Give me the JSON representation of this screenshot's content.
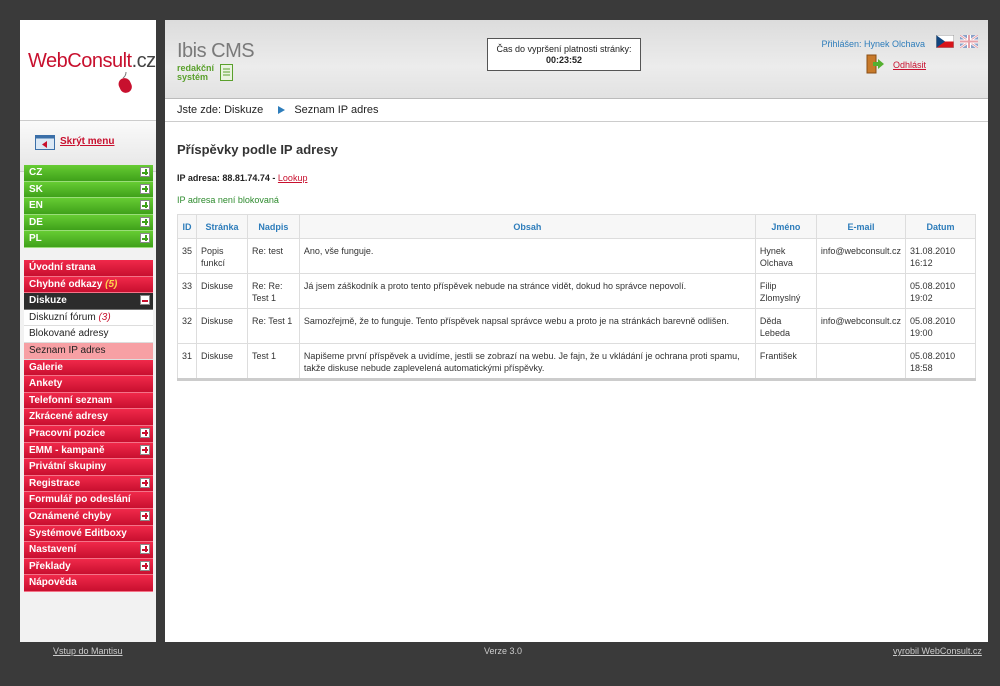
{
  "brand": {
    "name": "WebConsult",
    "suffix": ".cz"
  },
  "sidebar": {
    "hide_menu_label": "Skrýt menu",
    "languages": [
      {
        "label": "CZ"
      },
      {
        "label": "SK"
      },
      {
        "label": "EN"
      },
      {
        "label": "DE"
      },
      {
        "label": "PL"
      }
    ],
    "items": [
      {
        "label": "Úvodní strana"
      },
      {
        "label": "Chybné odkazy",
        "count": "(5)"
      },
      {
        "label": "Diskuze"
      },
      {
        "label": "Diskuzní fórum",
        "count": "(3)"
      },
      {
        "label": "Blokované adresy"
      },
      {
        "label": "Seznam IP adres"
      },
      {
        "label": "Galerie"
      },
      {
        "label": "Ankety"
      },
      {
        "label": "Telefonní seznam"
      },
      {
        "label": "Zkrácené adresy"
      },
      {
        "label": "Pracovní pozice"
      },
      {
        "label": "EMM - kampaně"
      },
      {
        "label": "Privátní skupiny"
      },
      {
        "label": "Registrace"
      },
      {
        "label": "Formulář po odeslání"
      },
      {
        "label": "Oznámené chyby"
      },
      {
        "label": "Systémové Editboxy"
      },
      {
        "label": "Nastavení"
      },
      {
        "label": "Překlady"
      },
      {
        "label": "Nápověda"
      }
    ]
  },
  "header": {
    "cms_title": "Ibis CMS",
    "cms_subtitle": "redakční systém",
    "timer_label": "Čas do vypršení platnosti stránky:",
    "timer_value": "00:23:52",
    "logged_in": "Přihlášen: Hynek Olchava",
    "logout": "Odhlásit"
  },
  "breadcrumb": {
    "prefix": "Jste zde:",
    "items": [
      "Diskuze",
      "Seznam IP adres"
    ]
  },
  "content": {
    "title": "Příspěvky podle IP adresy",
    "ip_label": "IP adresa: 88.81.74.74 -",
    "lookup": "Lookup",
    "status": "IP adresa není blokovaná",
    "columns": [
      "ID",
      "Stránka",
      "Nadpis",
      "Obsah",
      "Jméno",
      "E-mail",
      "Datum"
    ],
    "rows": [
      {
        "id": "35",
        "page": "Popis funkcí",
        "title": "Re: test",
        "content": "Ano, vše funguje.",
        "name": "Hynek Olchava",
        "email": "info@webconsult.cz",
        "date": "31.08.2010 16:12"
      },
      {
        "id": "33",
        "page": "Diskuse",
        "title": "Re: Re: Test 1",
        "content": "Já jsem záškodník a proto tento příspěvek nebude na stránce vidět, dokud ho správce nepovolí.",
        "name": "Filip Zlomyslný",
        "email": "",
        "date": "05.08.2010 19:02"
      },
      {
        "id": "32",
        "page": "Diskuse",
        "title": "Re: Test 1",
        "content": "Samozřejmě, že to funguje. Tento příspěvek napsal správce webu a proto je na stránkách barevně odlišen.",
        "name": "Děda Lebeda",
        "email": "info@webconsult.cz",
        "date": "05.08.2010 19:00"
      },
      {
        "id": "31",
        "page": "Diskuse",
        "title": "Test 1",
        "content": "Napišeme první příspěvek a uvidíme, jestli se zobrazí na webu. Je fajn, že u vkládání je ochrana proti spamu, takže diskuse nebude zaplevelená automatickými příspěvky.",
        "name": "František",
        "email": "",
        "date": "05.08.2010 18:58"
      }
    ]
  },
  "footer": {
    "left": "Vstup do Mantisu",
    "middle": "Verze 3.0",
    "right": "vyrobil WebConsult.cz"
  },
  "colors": {
    "accent_red": "#c8102e",
    "menu_green": "#3fa11a",
    "link_blue": "#2e7dbb"
  }
}
